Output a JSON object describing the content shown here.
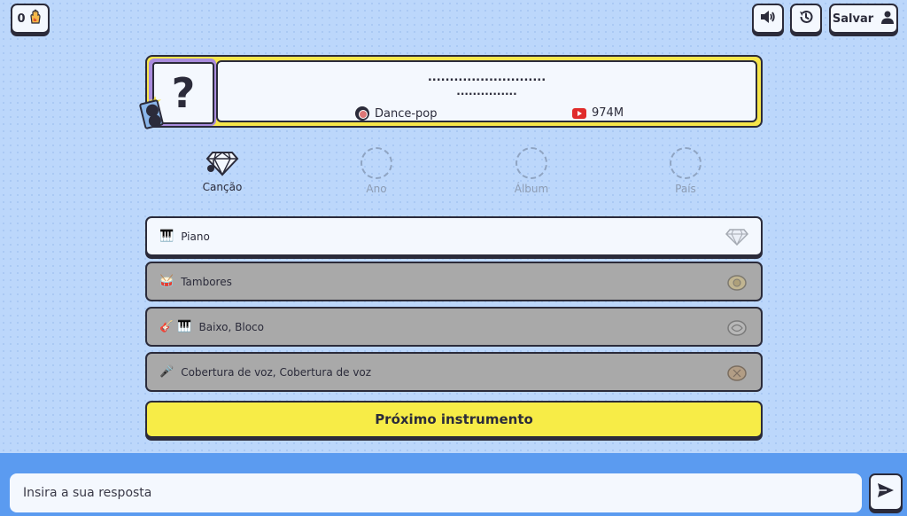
{
  "header": {
    "streak_count": "0",
    "save_label": "Salvar"
  },
  "song": {
    "title_hidden": "...........................",
    "artist_hidden": "...............",
    "genre": "Dance-pop",
    "views": "974M",
    "cover_placeholder": "?"
  },
  "categories": [
    {
      "label": "Canção",
      "state": "solved"
    },
    {
      "label": "Ano",
      "state": "empty"
    },
    {
      "label": "Álbum",
      "state": "empty"
    },
    {
      "label": "País",
      "state": "empty"
    }
  ],
  "instruments": [
    {
      "emoji": "🎹",
      "label": "Piano",
      "state": "active",
      "icon": "diamond-badge-icon"
    },
    {
      "emoji": "🥁",
      "label": "Tambores",
      "state": "disabled",
      "icon": "gold-badge-icon"
    },
    {
      "emoji": "🎸 🎹",
      "label": "Baixo, Bloco",
      "state": "disabled",
      "icon": "silver-badge-icon"
    },
    {
      "emoji": "🎤",
      "label": "Cobertura de voz, Cobertura de voz",
      "state": "disabled",
      "icon": "bronze-badge-icon"
    }
  ],
  "next_button": "Próximo instrumento",
  "answer": {
    "placeholder": "Insira a sua resposta",
    "value": ""
  },
  "colors": {
    "background": "#bcd7fb",
    "accent_yellow": "#f7ec47",
    "bottom_bar": "#5b9bf0",
    "dark": "#2b2b3a"
  }
}
